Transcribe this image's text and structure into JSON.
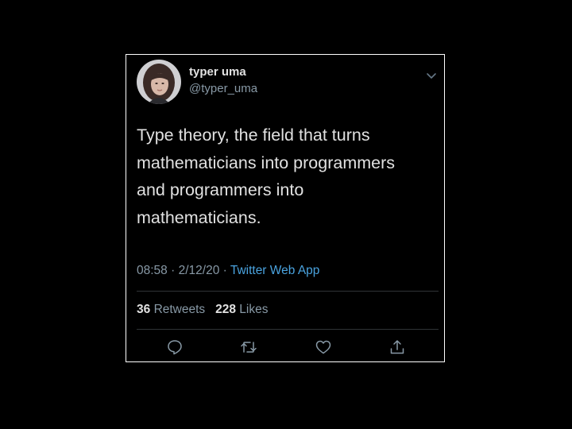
{
  "tweet": {
    "display_name": "typer uma",
    "handle": "@typer_uma",
    "text_lines": [
      "Type theory, the field that turns",
      "mathematicians into programmers",
      "and programmers into",
      "mathematicians."
    ],
    "time": "08:58",
    "date": "2/12/20",
    "separator": "·",
    "source": "Twitter Web App",
    "retweets_count": "36",
    "retweets_label": "Retweets",
    "likes_count": "228",
    "likes_label": "Likes"
  },
  "icons": {
    "menu": "chevron-down-icon",
    "reply": "reply-icon",
    "retweet": "retweet-icon",
    "like": "heart-icon",
    "share": "share-icon"
  },
  "colors": {
    "background": "#000000",
    "border": "#ffffff",
    "text": "#e1e1e1",
    "secondary": "#8899a6",
    "link": "#4aa3df",
    "divider": "#2f3336"
  }
}
